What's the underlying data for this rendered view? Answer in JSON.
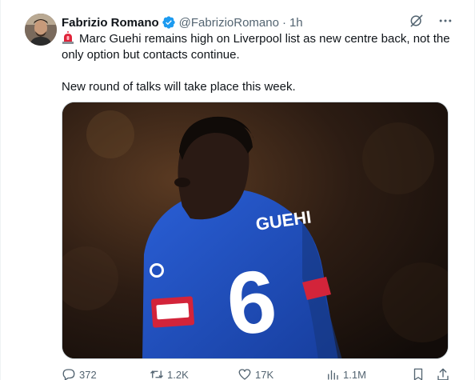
{
  "author": {
    "name": "Fabrizio Romano",
    "handle": "@FabrizioRomano",
    "separator": "·",
    "time": "1h"
  },
  "tweet": {
    "line1": "Marc Guehi remains high on Liverpool list as new centre back, not the only option but contacts continue.",
    "line2": "New round of talks will take place this week.",
    "emoji_icon": "police-siren-icon"
  },
  "media": {
    "shirt_name": "GUEHI",
    "shirt_number": "6",
    "colors": {
      "shirt": "#1f4fbf",
      "accent": "#d3243a",
      "background": "#1c1410"
    }
  },
  "actions": {
    "replies": "372",
    "reposts": "1.2K",
    "likes": "17K",
    "views": "1.1M"
  },
  "icons": [
    "verified-badge-icon",
    "grok-icon",
    "more-icon",
    "reply-icon",
    "repost-icon",
    "like-icon",
    "views-icon",
    "bookmark-icon",
    "share-icon"
  ],
  "colors": {
    "verified": "#1d9bf0",
    "muted": "#536471",
    "text": "#0f1419"
  }
}
